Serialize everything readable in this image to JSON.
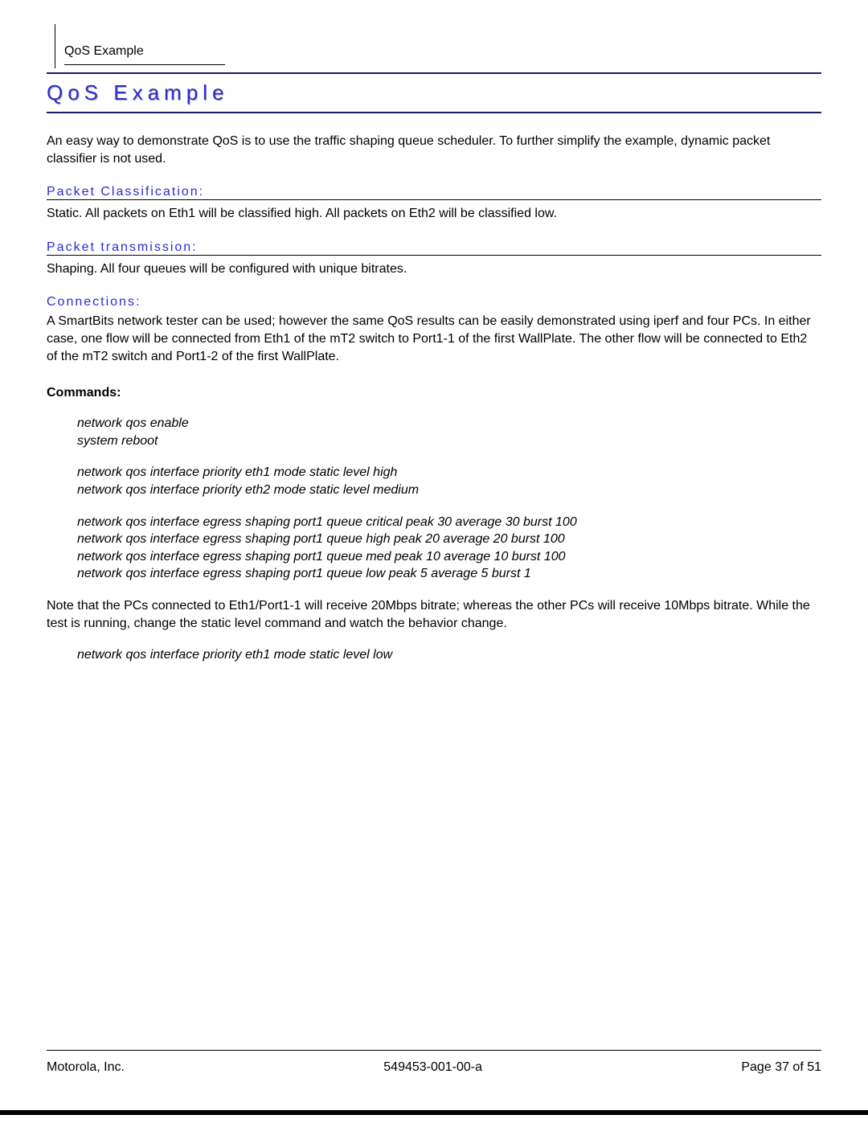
{
  "header": {
    "running": "QoS Example"
  },
  "title": "QoS Example",
  "intro": "An easy way to demonstrate QoS is to use the traffic shaping queue scheduler.  To further simplify the example, dynamic packet classifier is not used.",
  "sections": {
    "classification": {
      "heading": "Packet Classification:",
      "body": "Static.  All packets on Eth1 will be classified high.  All packets on Eth2 will be classified low."
    },
    "transmission": {
      "heading": "Packet transmission:",
      "body": "Shaping.  All four queues will be configured with unique bitrates."
    },
    "connections": {
      "heading": "Connections:",
      "body": "A SmartBits network tester can be used; however the same QoS results can be easily demonstrated using iperf and four PCs.  In either case, one flow will be connected from Eth1 of the mT2 switch to Port1-1 of the first WallPlate.  The other flow will be connected to Eth2 of the mT2 switch and Port1-2 of the first WallPlate."
    }
  },
  "commands_label": "Commands:",
  "commands": {
    "block1": [
      "network qos enable",
      "system reboot"
    ],
    "block2": [
      "network qos interface priority eth1 mode static level high",
      "network qos interface priority eth2 mode static level medium"
    ],
    "block3": [
      "network qos interface egress shaping port1 queue critical peak 30 average 30 burst 100",
      "network qos interface egress shaping port1 queue high peak 20 average 20 burst 100",
      "network qos interface egress shaping port1 queue med peak 10 average 10 burst 100",
      "network qos interface egress shaping port1 queue low peak 5 average 5 burst 1"
    ]
  },
  "note": "Note that the PCs connected to Eth1/Port1-1 will receive 20Mbps bitrate; whereas the other PCs will receive 10Mbps bitrate.  While the test is running, change the static level command and watch the behavior change.",
  "final_command": "network qos interface priority eth1 mode static level low",
  "footer": {
    "left": "Motorola, Inc.",
    "center": "549453-001-00-a",
    "right": "Page 37 of 51"
  }
}
